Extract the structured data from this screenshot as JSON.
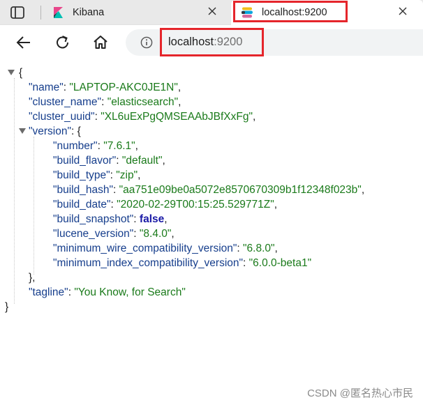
{
  "tabs": [
    {
      "title": "Kibana",
      "active": false,
      "favicon": "kibana-logo-icon"
    },
    {
      "title": "localhost:9200",
      "active": true,
      "favicon": "elastic-logo-icon"
    }
  ],
  "address": {
    "host": "localhost",
    "port": ":9200"
  },
  "json": {
    "open_brace": "{",
    "close_brace": "}",
    "name_key": "\"name\"",
    "name_val": "\"LAPTOP-AKC0JE1N\"",
    "cluster_name_key": "\"cluster_name\"",
    "cluster_name_val": "\"elasticsearch\"",
    "cluster_uuid_key": "\"cluster_uuid\"",
    "cluster_uuid_val": "\"XL6uExPgQMSEAAbJBfXxFg\"",
    "version_key": "\"version\"",
    "version_open": "{",
    "number_key": "\"number\"",
    "number_val": "\"7.6.1\"",
    "build_flavor_key": "\"build_flavor\"",
    "build_flavor_val": "\"default\"",
    "build_type_key": "\"build_type\"",
    "build_type_val": "\"zip\"",
    "build_hash_key": "\"build_hash\"",
    "build_hash_val": "\"aa751e09be0a5072e8570670309b1f12348f023b\"",
    "build_date_key": "\"build_date\"",
    "build_date_val": "\"2020-02-29T00:15:25.529771Z\"",
    "build_snapshot_key": "\"build_snapshot\"",
    "build_snapshot_val": "false",
    "lucene_version_key": "\"lucene_version\"",
    "lucene_version_val": "\"8.4.0\"",
    "min_wire_key": "\"minimum_wire_compatibility_version\"",
    "min_wire_val": "\"6.8.0\"",
    "min_index_key": "\"minimum_index_compatibility_version\"",
    "min_index_val": "\"6.0.0-beta1\"",
    "version_close": "},",
    "tagline_key": "\"tagline\"",
    "tagline_val": "\"You Know, for Search\""
  },
  "watermark": "CSDN @匿名热心市民",
  "colors": {
    "highlight": "#e5252b",
    "string": "#1a7a1a",
    "boolean": "#1a1aa6"
  }
}
